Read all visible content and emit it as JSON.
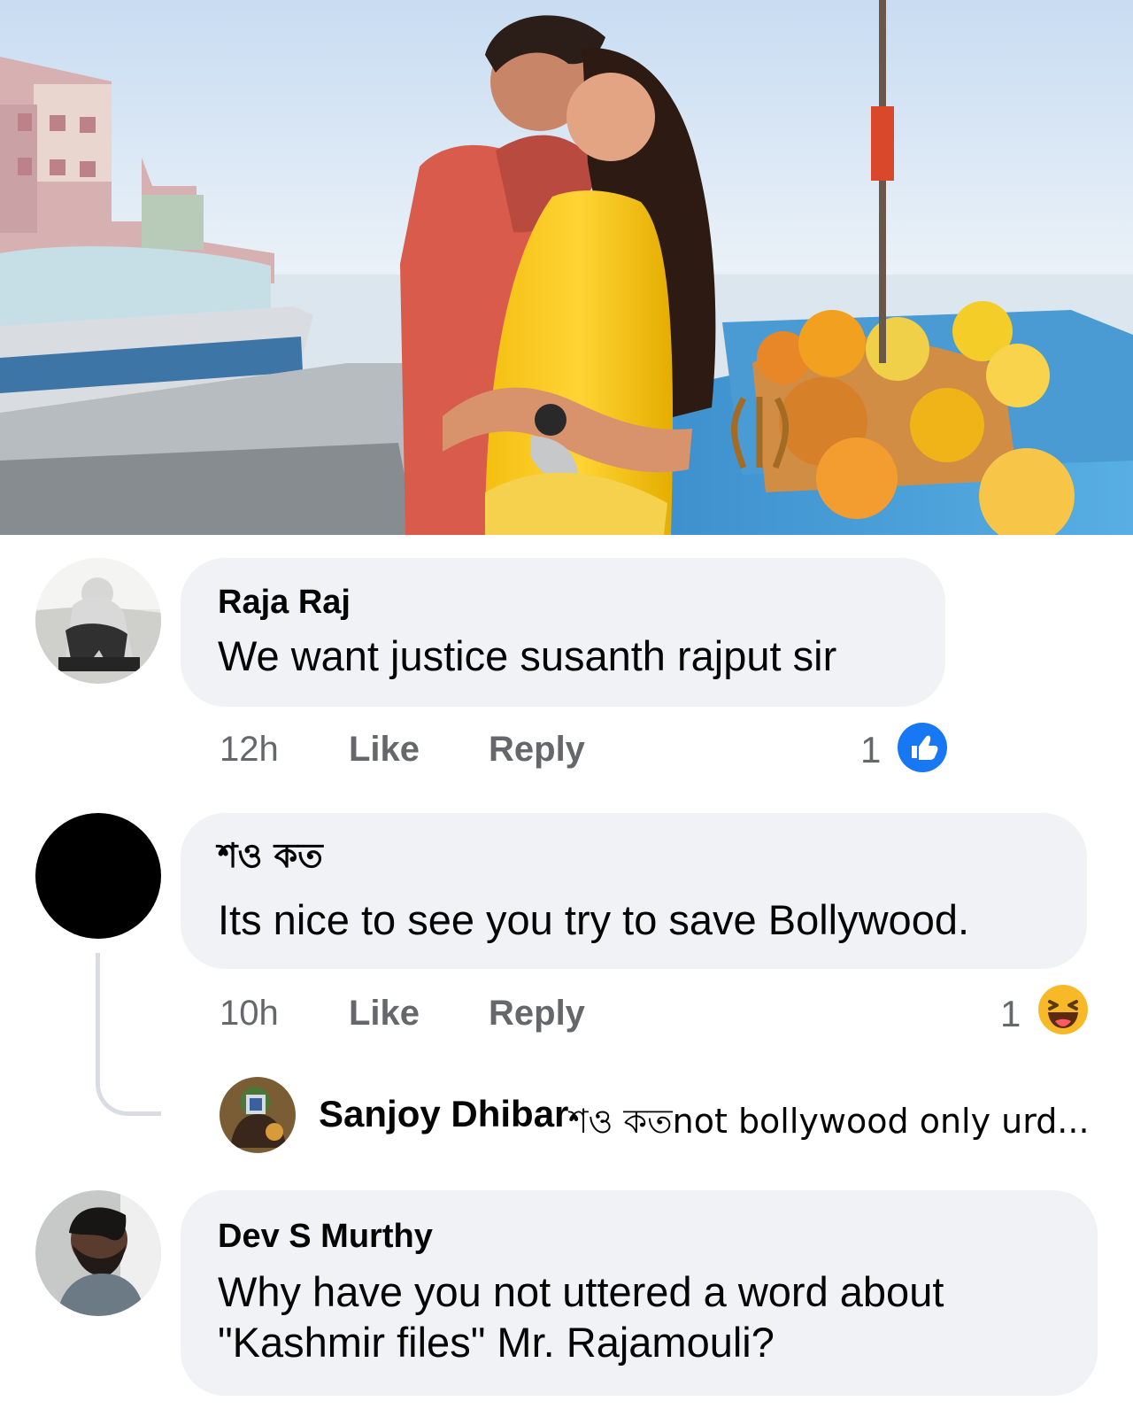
{
  "post": {
    "image": {
      "subject": "couple-on-river-boat-photo"
    }
  },
  "comments": [
    {
      "author": "Raja Raj",
      "text": "We want justice susanth rajput sir",
      "time": "12h",
      "like_label": "Like",
      "reply_label": "Reply",
      "reaction_count": "1",
      "reaction_icon": "like-reaction-icon"
    },
    {
      "author": "শও কত",
      "text": "Its nice to see you try to save Bollywood.",
      "time": "10h",
      "like_label": "Like",
      "reply_label": "Reply",
      "reaction_count": "1",
      "reaction_icon": "haha-reaction-icon",
      "reply_preview": {
        "author": "Sanjoy Dhibar",
        "text": "শও কতnot bollywood only urd..."
      }
    },
    {
      "author": "Dev S Murthy",
      "text": "Why have you not uttered a word about\n\"Kashmir files\" Mr. Rajamouli?"
    }
  ],
  "colors": {
    "bubble_background": "#f0f2f5",
    "secondary_text": "#65676b",
    "like_blue": "#1877f2",
    "haha_yellow": "#f7b928"
  }
}
